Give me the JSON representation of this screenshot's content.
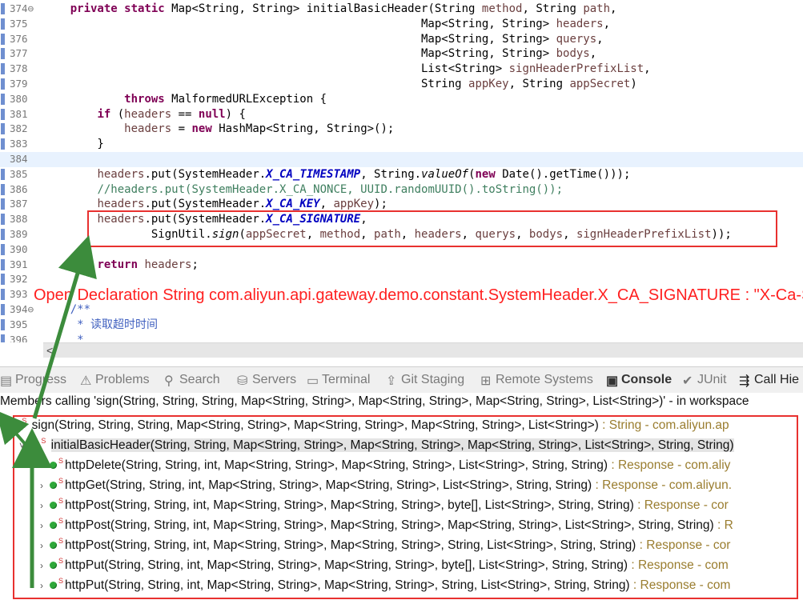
{
  "editor": {
    "lines": [
      {
        "n": "374",
        "fold": "⊖",
        "code": [
          [
            "",
            "    "
          ],
          [
            "kw",
            "private static"
          ],
          [
            "",
            " Map<String, String> initialBasicHeader(String "
          ],
          [
            "pm",
            "method"
          ],
          [
            "",
            ", String "
          ],
          [
            "pm",
            "path"
          ],
          [
            "",
            ","
          ]
        ]
      },
      {
        "n": "375",
        "code": [
          [
            "",
            "                                                        Map<String, String> "
          ],
          [
            "pm",
            "headers"
          ],
          [
            "",
            ","
          ]
        ]
      },
      {
        "n": "376",
        "code": [
          [
            "",
            "                                                        Map<String, String> "
          ],
          [
            "pm",
            "querys"
          ],
          [
            "",
            ","
          ]
        ]
      },
      {
        "n": "377",
        "code": [
          [
            "",
            "                                                        Map<String, String> "
          ],
          [
            "pm",
            "bodys"
          ],
          [
            "",
            ","
          ]
        ]
      },
      {
        "n": "378",
        "code": [
          [
            "",
            "                                                        List<String> "
          ],
          [
            "pm",
            "signHeaderPrefixList"
          ],
          [
            "",
            ","
          ]
        ]
      },
      {
        "n": "379",
        "code": [
          [
            "",
            "                                                        String "
          ],
          [
            "pm",
            "appKey"
          ],
          [
            "",
            ", String "
          ],
          [
            "pm",
            "appSecret"
          ],
          [
            "",
            ")"
          ]
        ]
      },
      {
        "n": "380",
        "code": [
          [
            "",
            "            "
          ],
          [
            "kw",
            "throws"
          ],
          [
            "",
            " MalformedURLException {"
          ]
        ]
      },
      {
        "n": "381",
        "code": [
          [
            "",
            "        "
          ],
          [
            "kw",
            "if"
          ],
          [
            "",
            " ("
          ],
          [
            "pm",
            "headers"
          ],
          [
            "",
            " == "
          ],
          [
            "kw",
            "null"
          ],
          [
            "",
            ") {"
          ]
        ]
      },
      {
        "n": "382",
        "code": [
          [
            "",
            "            "
          ],
          [
            "pm",
            "headers"
          ],
          [
            "",
            " = "
          ],
          [
            "kw",
            "new"
          ],
          [
            "",
            " HashMap<String, String>();"
          ]
        ]
      },
      {
        "n": "383",
        "code": [
          [
            "",
            "        }"
          ]
        ]
      },
      {
        "n": "384",
        "code": [
          [
            "",
            ""
          ]
        ],
        "current": true
      },
      {
        "n": "385",
        "code": [
          [
            "",
            "        "
          ],
          [
            "pm",
            "headers"
          ],
          [
            "",
            ".put(SystemHeader."
          ],
          [
            "sf",
            "X_CA_TIMESTAMP"
          ],
          [
            "",
            ", String."
          ],
          [
            "si",
            "valueOf"
          ],
          [
            "",
            "("
          ],
          [
            "kw",
            "new"
          ],
          [
            "",
            " Date().getTime()));"
          ]
        ]
      },
      {
        "n": "386",
        "code": [
          [
            "",
            "        "
          ],
          [
            "cm",
            "//headers.put(SystemHeader.X_CA_NONCE, UUID.randomUUID().toString());"
          ]
        ]
      },
      {
        "n": "387",
        "code": [
          [
            "",
            "        "
          ],
          [
            "pm",
            "headers"
          ],
          [
            "",
            ".put(SystemHeader."
          ],
          [
            "sf",
            "X_CA_KEY"
          ],
          [
            "",
            ", "
          ],
          [
            "pm",
            "appKey"
          ],
          [
            "",
            ");"
          ]
        ]
      },
      {
        "n": "388",
        "code": [
          [
            "",
            "        "
          ],
          [
            "pm",
            "headers"
          ],
          [
            "",
            ".put(SystemHeader."
          ],
          [
            "sf",
            "X_CA_SIGNATURE"
          ],
          [
            "",
            ","
          ]
        ]
      },
      {
        "n": "389",
        "code": [
          [
            "",
            "                SignUtil."
          ],
          [
            "si",
            "sign"
          ],
          [
            "",
            "("
          ],
          [
            "pm",
            "appSecret"
          ],
          [
            "",
            ", "
          ],
          [
            "pm",
            "method"
          ],
          [
            "",
            ", "
          ],
          [
            "pm",
            "path"
          ],
          [
            "",
            ", "
          ],
          [
            "pm",
            "headers"
          ],
          [
            "",
            ", "
          ],
          [
            "pm",
            "querys"
          ],
          [
            "",
            ", "
          ],
          [
            "pm",
            "bodys"
          ],
          [
            "",
            ", "
          ],
          [
            "pm",
            "signHeaderPrefixList"
          ],
          [
            "",
            "));"
          ]
        ]
      },
      {
        "n": "390",
        "code": [
          [
            "",
            ""
          ]
        ]
      },
      {
        "n": "391",
        "code": [
          [
            "",
            "        "
          ],
          [
            "kw",
            "return"
          ],
          [
            "",
            " "
          ],
          [
            "pm",
            "headers"
          ],
          [
            "",
            ";"
          ]
        ]
      },
      {
        "n": "392",
        "code": [
          [
            "",
            ""
          ]
        ]
      },
      {
        "n": "393",
        "code": [
          [
            "",
            ""
          ]
        ]
      },
      {
        "n": "394",
        "fold": "⊖",
        "code": [
          [
            "",
            "    "
          ],
          [
            "jd",
            "/**"
          ]
        ]
      },
      {
        "n": "395",
        "code": [
          [
            "",
            "     "
          ],
          [
            "jd",
            "* 读取超时时间"
          ]
        ]
      },
      {
        "n": "396",
        "code": [
          [
            "",
            "     "
          ],
          [
            "jd",
            "*"
          ]
        ]
      }
    ],
    "hover_tooltip": "Open Declaration String com.aliyun.api.gateway.demo.constant.SystemHeader.X_CA_SIGNATURE : \"X-Ca-Si",
    "scroll_left_arrow": "<"
  },
  "tabs": [
    {
      "label": "Progress",
      "icon": "progress-icon"
    },
    {
      "label": "Problems",
      "icon": "problems-icon"
    },
    {
      "label": "Search",
      "icon": "search-icon"
    },
    {
      "label": "Servers",
      "icon": "servers-icon"
    },
    {
      "label": "Terminal",
      "icon": "terminal-icon"
    },
    {
      "label": "Git Staging",
      "icon": "git-staging-icon"
    },
    {
      "label": "Remote Systems",
      "icon": "remote-systems-icon"
    },
    {
      "label": "Console",
      "icon": "console-icon"
    },
    {
      "label": "JUnit",
      "icon": "junit-icon"
    },
    {
      "label": "Call Hie",
      "icon": "call-hierarchy-icon"
    }
  ],
  "call_hierarchy": {
    "description": "Members calling 'sign(String, String, String, Map<String, String>, Map<String, String>, Map<String, String>, List<String>)' - in workspace",
    "root": {
      "name": "sign(String, String, String, Map<String, String>, Map<String, String>, Map<String, String>, List<String>)",
      "ret": " : String - com.aliyun.ap"
    },
    "caller": {
      "name": "initialBasicHeader(String, String, Map<String, String>, Map<String, String>, Map<String, String>, List<String>, String, String)",
      "ret": ""
    },
    "children": [
      {
        "name": "httpDelete(String, String, int, Map<String, String>, Map<String, String>, List<String>, String, String)",
        "ret": " : Response - com.aliy"
      },
      {
        "name": "httpGet(String, String, int, Map<String, String>, Map<String, String>, List<String>, String, String)",
        "ret": " : Response - com.aliyun."
      },
      {
        "name": "httpPost(String, String, int, Map<String, String>, Map<String, String>, byte[], List<String>, String, String)",
        "ret": " : Response - cor"
      },
      {
        "name": "httpPost(String, String, int, Map<String, String>, Map<String, String>, Map<String, String>, List<String>, String, String)",
        "ret": " : R"
      },
      {
        "name": "httpPost(String, String, int, Map<String, String>, Map<String, String>, String, List<String>, String, String)",
        "ret": " : Response - cor"
      },
      {
        "name": "httpPut(String, String, int, Map<String, String>, Map<String, String>, byte[], List<String>, String, String)",
        "ret": " : Response - com"
      },
      {
        "name": "httpPut(String, String, int, Map<String, String>, Map<String, String>, String, List<String>, String, String)",
        "ret": " : Response - com"
      }
    ]
  },
  "colors": {
    "annotation_red": "#e8312f",
    "arrow_green": "#3c8c3c"
  }
}
